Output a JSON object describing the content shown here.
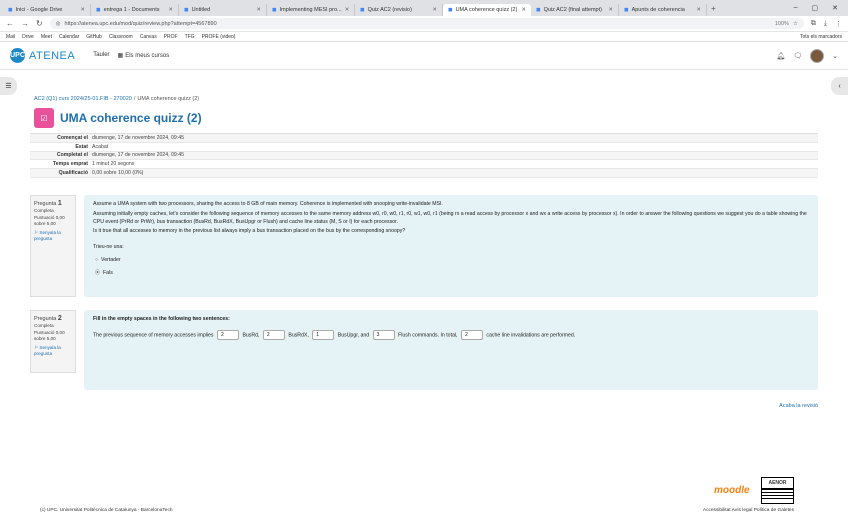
{
  "browser": {
    "tabs": [
      {
        "label": "Inici - Google Drive",
        "active": false
      },
      {
        "label": "entrega 1 - Documents",
        "active": false
      },
      {
        "label": "Untitled",
        "active": false
      },
      {
        "label": "Implementing MESI pro...",
        "active": false
      },
      {
        "label": "Quiz AC2 (revisio)",
        "active": false
      },
      {
        "label": "UMA coherence quizz (2)",
        "active": true
      },
      {
        "label": "Quiz AC2 (final attempt)",
        "active": false
      },
      {
        "label": "Apunts de coherencia",
        "active": false
      }
    ],
    "url": "https://atenea.upc.edu/mod/quiz/review.php?attempt=4567890",
    "zoom": "100%",
    "bookmarks": [
      "Mail",
      "Drive",
      "Meet",
      "Calendar",
      "GitHub",
      "Classroom",
      "Canvas",
      "PROF",
      "TFG",
      "PROFE (video)"
    ],
    "all_bookmarks": "Tots els marcadors"
  },
  "navbar": {
    "logo_short": "UPC",
    "logo_text": "ATENEA",
    "links": [
      "Tauler",
      "Els meus cursos"
    ]
  },
  "breadcrumb": {
    "course": "AC2 (Q1) curs 2024/25-01.FIB - 270020",
    "current": "UMA coherence quizz (2)"
  },
  "page_title": "UMA coherence quizz (2)",
  "summary": [
    {
      "key": "Començat el",
      "value": "diumenge, 17 de novembre 2024, 09:45"
    },
    {
      "key": "Estat",
      "value": "Acabat"
    },
    {
      "key": "Completat el",
      "value": "diumenge, 17 de novembre 2024, 09:45"
    },
    {
      "key": "Temps emprat",
      "value": "1 minut 20 segons"
    },
    {
      "key": "Qualificació",
      "value": "0,00 sobre 10,00 (0%)"
    }
  ],
  "question1": {
    "label": "Pregunta",
    "number": "1",
    "status": "Completa",
    "mark": "Puntuació 0,00 sobre 5,00",
    "flag": "Senyala la pregunta",
    "text1": "Assume a UMA system with two processors, sharing the access to 8 GB of main memory. Coherence is implemented with snooping write-invalidate MSI.",
    "text2": "Assuming initially empty caches, let's consider the following sequence of memory accesses to the same memory address w0, r0, w0, r1, r0, w1, w0, r1 (being rx a read access by processor x and wx a write access by processor x). In order to answer the following questions we suggest you do a table showing the CPU event (PrRd or PrWr), bus transaction (BusRd, BusRdX, BusUpgr or Flush) and cache line status (M, S or I) for each processor.",
    "text3": "Is it true that all accesses to memory in the previous list always imply a bus transaction placed on the bus by the corresponding snoopy?",
    "prompt": "Trieu-ne una:",
    "options": [
      "Vertader",
      "Fals"
    ],
    "selected": 1
  },
  "question2": {
    "label": "Pregunta",
    "number": "2",
    "status": "Completa",
    "mark": "Puntuació 0,00 sobre 5,00",
    "flag": "Senyala la pregunta",
    "title": "Fill in the empty spaces in the following two sentences:",
    "t1": "The previous sequence of memory accesses implies",
    "v1": "2",
    "t2": "BusRd,",
    "v2": "2",
    "t3": "BusRdX,",
    "v3": "1",
    "t4": "BusUpgr, and",
    "v4": "3",
    "t5": "Flush commands. In total,",
    "v5": "2",
    "t6": "cache line invalidations are performed."
  },
  "finish_link": "Acaba la revisió",
  "footer": {
    "left": "(c) UPC. Universitat Politècnica de Catalunya · BarcelonaTech",
    "right": "Accessibilitat   Avís legal   Política de Galetes",
    "moodle": "moodle",
    "aenor": "AENOR"
  }
}
